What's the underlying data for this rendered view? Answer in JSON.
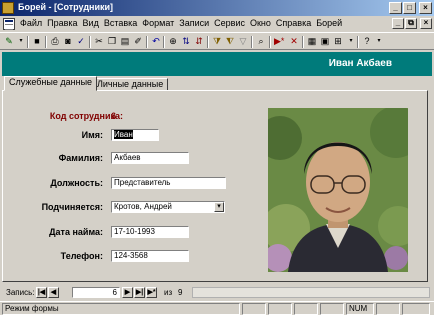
{
  "window": {
    "title": "Борей - [Сотрудники]"
  },
  "menu": {
    "items": [
      "Файл",
      "Правка",
      "Вид",
      "Вставка",
      "Формат",
      "Записи",
      "Сервис",
      "Окно",
      "Справка",
      "Борей"
    ]
  },
  "header": {
    "employee_name": "Иван Акбаев"
  },
  "tabs": [
    {
      "label": "Служебные данные",
      "active": true
    },
    {
      "label": "Личные данные",
      "active": false
    }
  ],
  "form": {
    "employee_code": {
      "label": "Код сотрудника:",
      "value": "6"
    },
    "first_name": {
      "label": "Имя:",
      "value": "Иван"
    },
    "last_name": {
      "label": "Фамилия:",
      "value": "Акбаев"
    },
    "position": {
      "label": "Должность:",
      "value": "Представитель"
    },
    "reports_to": {
      "label": "Подчиняется:",
      "value": "Кротов, Андрей"
    },
    "hire_date": {
      "label": "Дата найма:",
      "value": "17-10-1993"
    },
    "phone": {
      "label": "Телефон:",
      "value": "124-3568"
    }
  },
  "navigation": {
    "label": "Запись:",
    "current": "6",
    "of_label": "из",
    "total": "9"
  },
  "status": {
    "mode": "Режим формы",
    "num": "NUM"
  },
  "colors": {
    "header_bg": "#007b7b",
    "title_gradient_start": "#0a246a",
    "code_label": "#800000"
  }
}
